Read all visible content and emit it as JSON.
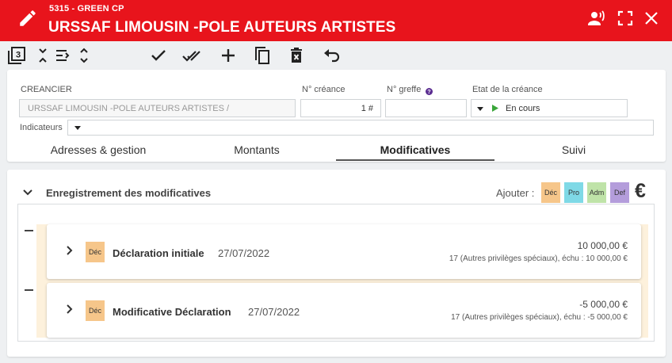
{
  "header": {
    "subtitle": "5315 - GREEN CP",
    "title": "URSSAF LIMOUSIN -POLE AUTEURS ARTISTES"
  },
  "form": {
    "creancier_label": "CREANCIER",
    "creancier_value": "URSSAF LIMOUSIN -POLE AUTEURS ARTISTES /",
    "num_creance_label": "N° créance",
    "num_creance_value": "1 #",
    "num_greffe_label": "N° greffe",
    "num_greffe_value": "",
    "etat_label": "Etat de la créance",
    "etat_value": "En cours",
    "indicateurs_label": "Indicateurs"
  },
  "tabs": [
    "Adresses & gestion",
    "Montants",
    "Modificatives",
    "Suivi"
  ],
  "active_tab": "Modificatives",
  "section": {
    "title": "Enregistrement des modificatives",
    "ajouter_label": "Ajouter :",
    "tags": [
      {
        "label": "Déc",
        "color": "#f6c68a"
      },
      {
        "label": "Pro",
        "color": "#7fd9e6"
      },
      {
        "label": "Adm",
        "color": "#bfe3a8"
      },
      {
        "label": "Def",
        "color": "#b49ddb"
      }
    ],
    "euro_symbol": "€"
  },
  "entries": [
    {
      "tag": "Déc",
      "name": "Déclaration initiale",
      "date": "27/07/2022",
      "amount": "10 000,00 €",
      "detail": "17 (Autres privilèges spéciaux), échu : 10 000,00 €"
    },
    {
      "tag": "Déc",
      "name": "Modificative Déclaration",
      "date": "27/07/2022",
      "amount": "-5 000,00 €",
      "detail": "17 (Autres privilèges spéciaux), échu : -5 000,00 €"
    }
  ],
  "colors": {
    "header_bg": "#e8141c",
    "play_green": "#3aa63a",
    "help_purple": "#5b2d91"
  }
}
